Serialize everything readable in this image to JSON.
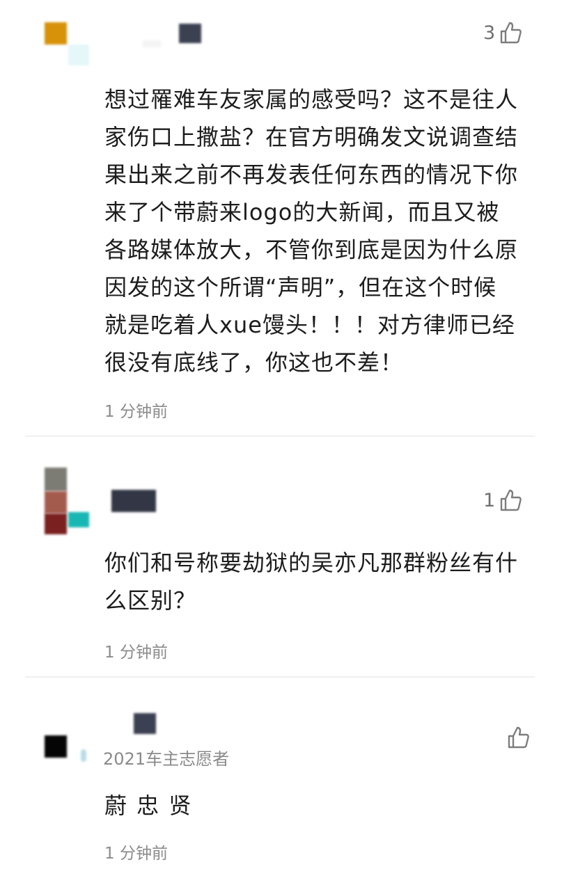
{
  "comments": [
    {
      "likes": "3",
      "text": "想过罹难车友家属的感受吗？这不是往人\n家伤口上撒盐？在官方明确发文说调查结\n果出来之前不再发表任何东西的情况下你\n来了个带蔚来logo的大新闻，而且又被\n各路媒体放大，不管你到底是因为什么原\n因发的这个所谓“声明”，但在这个时候\n就是吃着人xue馒头！！！对方律师已经\n很没有底线了，你这也不差！",
      "time": "1 分钟前"
    },
    {
      "likes": "1",
      "text": "你们和号称要劫狱的吴亦凡那群粉丝有什\n么区别？",
      "time": "1 分钟前"
    },
    {
      "likes": "",
      "badge": "2021车主志愿者",
      "text": "蔚 忠 贤",
      "time": "1 分钟前"
    }
  ],
  "colors": {
    "text": "#1c1c1c",
    "muted": "#8b8b8b",
    "divider": "#efefef"
  },
  "icons": {
    "like": "thumbs-up-icon"
  }
}
